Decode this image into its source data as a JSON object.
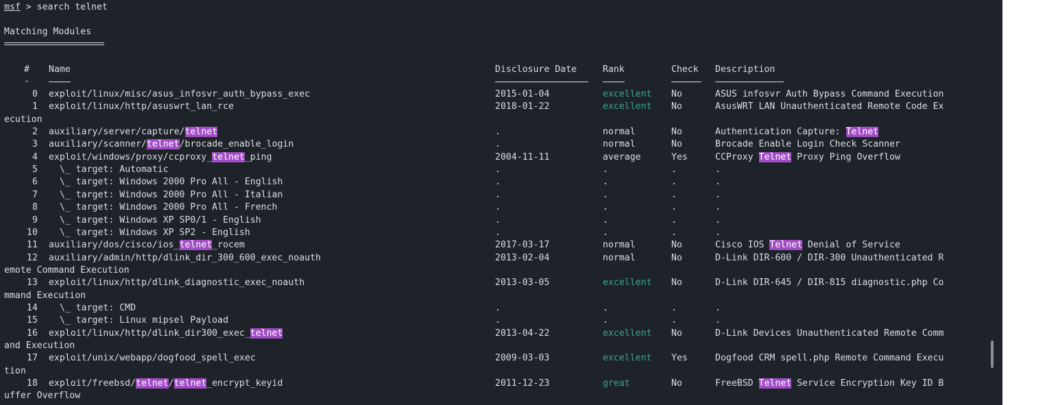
{
  "prompt": {
    "prefix": "msf",
    "separator": " > ",
    "command": "search telnet"
  },
  "section_title": "Matching Modules",
  "headers": {
    "num": "#",
    "name": "Name",
    "date": "Disclosure Date",
    "rank": "Rank",
    "check": "Check",
    "desc": "Description"
  },
  "under_num": "-",
  "highlight_term": "telnet",
  "lines": [
    {
      "num": "0",
      "name": "exploit/linux/misc/asus_infosvr_auth_bypass_exec",
      "date": "2015-01-04",
      "rank": "excellent",
      "check": "No",
      "desc": "ASUS infosvr Auth Bypass Command Execution"
    },
    {
      "num": "1",
      "name": "exploit/linux/http/asuswrt_lan_rce",
      "date": "2018-01-22",
      "rank": "excellent",
      "check": "No",
      "desc": "AsusWRT LAN Unauthenticated Remote Code Ex"
    },
    {
      "wrap": "ecution"
    },
    {
      "num": "2",
      "name": "auxiliary/server/capture/telnet",
      "date": ".",
      "rank": "normal",
      "check": "No",
      "desc": "Authentication Capture: Telnet"
    },
    {
      "num": "3",
      "name": "auxiliary/scanner/telnet/brocade_enable_login",
      "date": ".",
      "rank": "normal",
      "check": "No",
      "desc": "Brocade Enable Login Check Scanner"
    },
    {
      "num": "4",
      "name": "exploit/windows/proxy/ccproxy_telnet_ping",
      "date": "2004-11-11",
      "rank": "average",
      "check": "Yes",
      "desc": "CCProxy Telnet Proxy Ping Overflow"
    },
    {
      "num": "5",
      "name": "  \\_ target: Automatic",
      "date": ".",
      "rank": ".",
      "check": ".",
      "desc": "."
    },
    {
      "num": "6",
      "name": "  \\_ target: Windows 2000 Pro All - English",
      "date": ".",
      "rank": ".",
      "check": ".",
      "desc": "."
    },
    {
      "num": "7",
      "name": "  \\_ target: Windows 2000 Pro All - Italian",
      "date": ".",
      "rank": ".",
      "check": ".",
      "desc": "."
    },
    {
      "num": "8",
      "name": "  \\_ target: Windows 2000 Pro All - French",
      "date": ".",
      "rank": ".",
      "check": ".",
      "desc": "."
    },
    {
      "num": "9",
      "name": "  \\_ target: Windows XP SP0/1 - English",
      "date": ".",
      "rank": ".",
      "check": ".",
      "desc": "."
    },
    {
      "num": "10",
      "name": "  \\_ target: Windows XP SP2 - English",
      "date": ".",
      "rank": ".",
      "check": ".",
      "desc": "."
    },
    {
      "num": "11",
      "name": "auxiliary/dos/cisco/ios_telnet_rocem",
      "date": "2017-03-17",
      "rank": "normal",
      "check": "No",
      "desc": "Cisco IOS Telnet Denial of Service"
    },
    {
      "num": "12",
      "name": "auxiliary/admin/http/dlink_dir_300_600_exec_noauth",
      "date": "2013-02-04",
      "rank": "normal",
      "check": "No",
      "desc": "D-Link DIR-600 / DIR-300 Unauthenticated R"
    },
    {
      "wrap": "emote Command Execution"
    },
    {
      "num": "13",
      "name": "exploit/linux/http/dlink_diagnostic_exec_noauth",
      "date": "2013-03-05",
      "rank": "excellent",
      "check": "No",
      "desc": "D-Link DIR-645 / DIR-815 diagnostic.php Co"
    },
    {
      "wrap": "mmand Execution"
    },
    {
      "num": "14",
      "name": "  \\_ target: CMD",
      "date": ".",
      "rank": ".",
      "check": ".",
      "desc": "."
    },
    {
      "num": "15",
      "name": "  \\_ target: Linux mipsel Payload",
      "date": ".",
      "rank": ".",
      "check": ".",
      "desc": "."
    },
    {
      "num": "16",
      "name": "exploit/linux/http/dlink_dir300_exec_telnet",
      "date": "2013-04-22",
      "rank": "excellent",
      "check": "No",
      "desc": "D-Link Devices Unauthenticated Remote Comm"
    },
    {
      "wrap": "and Execution"
    },
    {
      "num": "17",
      "name": "exploit/unix/webapp/dogfood_spell_exec",
      "date": "2009-03-03",
      "rank": "excellent",
      "check": "Yes",
      "desc": "Dogfood CRM spell.php Remote Command Execu"
    },
    {
      "wrap": "tion"
    },
    {
      "num": "18",
      "name": "exploit/freebsd/telnet/telnet_encrypt_keyid",
      "date": "2011-12-23",
      "rank": "great",
      "check": "No",
      "desc": "FreeBSD Telnet Service Encryption Key ID B"
    },
    {
      "wrap": "uffer Overflow"
    }
  ],
  "colors": {
    "background": "#1e2229",
    "text": "#dcdfe4",
    "rank_good": "#3fa58c",
    "highlight": "#a24dc5"
  }
}
